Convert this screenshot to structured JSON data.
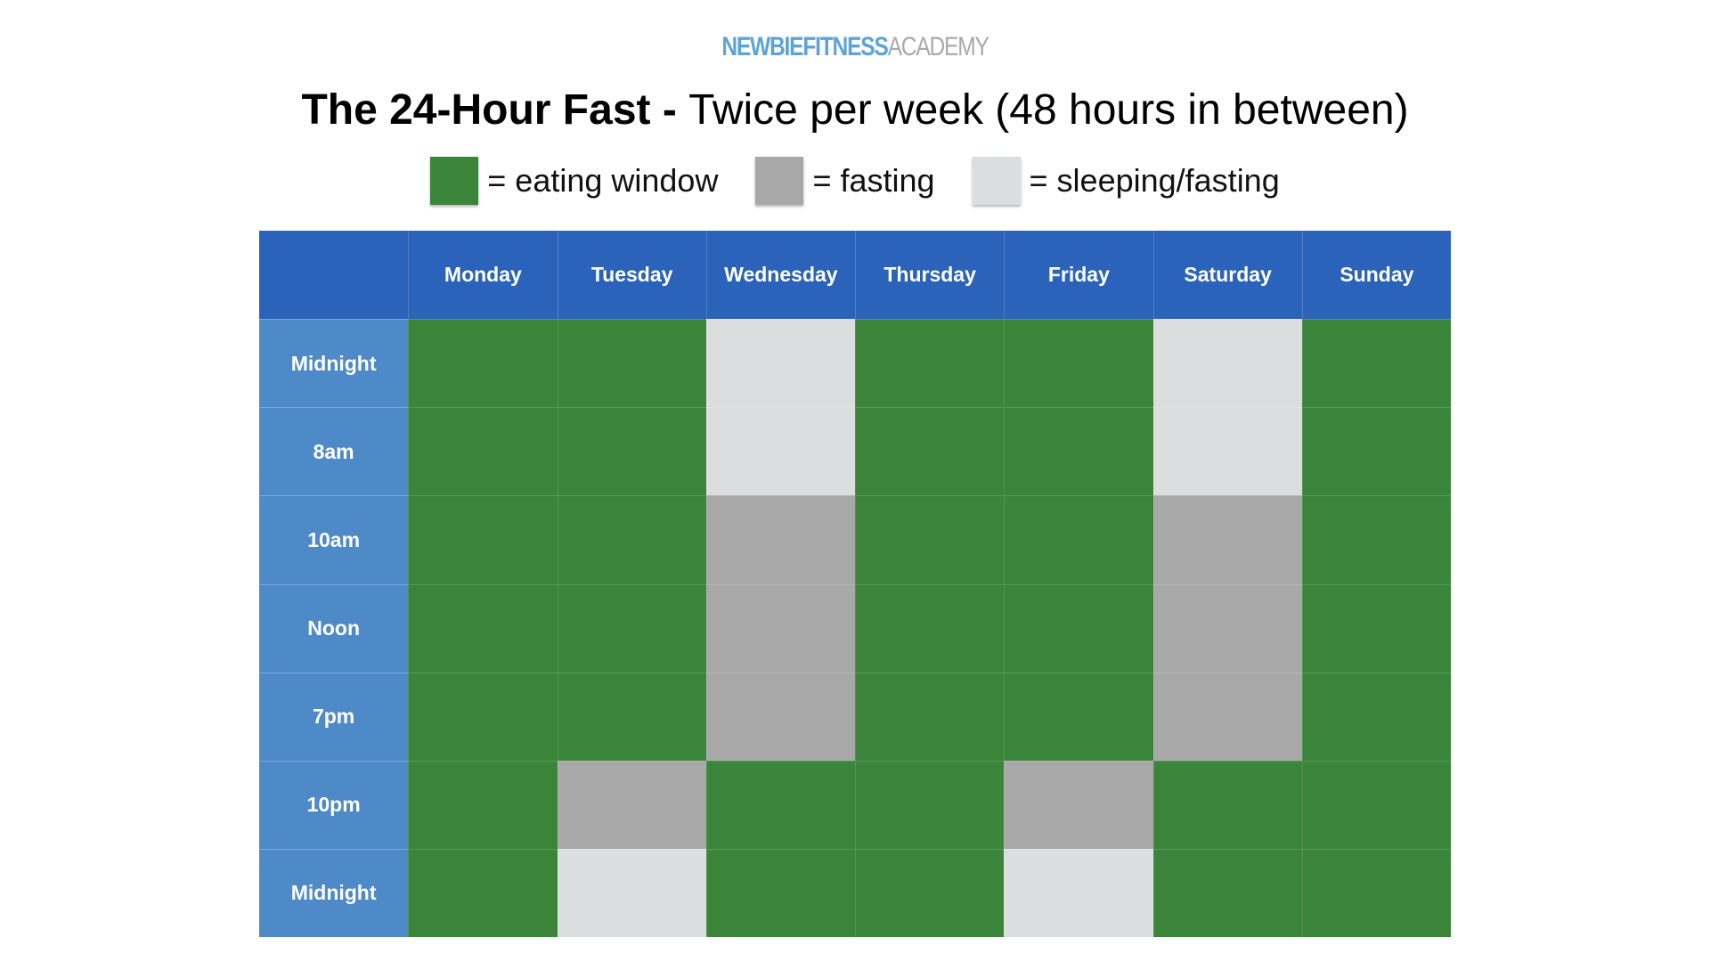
{
  "brand": {
    "part1": "NEWBIEFITNESS",
    "part2": "ACADEMY"
  },
  "title": {
    "bold": "The 24-Hour Fast - ",
    "light": "Twice per week (48 hours in between)"
  },
  "colors": {
    "eat": "#3b853a",
    "fast": "#a7a8a7",
    "sleep": "#dcdddf",
    "header": "#2b63ba",
    "row_header": "#4f8ac8"
  },
  "legend": [
    {
      "key": "eat",
      "label": "= eating window"
    },
    {
      "key": "fast",
      "label": "= fasting"
    },
    {
      "key": "sleep",
      "label": "= sleeping/fasting"
    }
  ],
  "chart_data": {
    "type": "heatmap",
    "title": "The 24-Hour Fast - Twice per week (48 hours in between)",
    "columns": [
      "Monday",
      "Tuesday",
      "Wednesday",
      "Thursday",
      "Friday",
      "Saturday",
      "Sunday"
    ],
    "rows": [
      "Midnight",
      "8am",
      "10am",
      "Noon",
      "7pm",
      "10pm",
      "Midnight"
    ],
    "legend": {
      "eat": "eating window",
      "fast": "fasting",
      "sleep": "sleeping/fasting"
    },
    "cells": [
      [
        "eat",
        "eat",
        "sleep",
        "eat",
        "eat",
        "sleep",
        "eat"
      ],
      [
        "eat",
        "eat",
        "sleep",
        "eat",
        "eat",
        "sleep",
        "eat"
      ],
      [
        "eat",
        "eat",
        "fast",
        "eat",
        "eat",
        "fast",
        "eat"
      ],
      [
        "eat",
        "eat",
        "fast",
        "eat",
        "eat",
        "fast",
        "eat"
      ],
      [
        "eat",
        "eat",
        "fast",
        "eat",
        "eat",
        "fast",
        "eat"
      ],
      [
        "eat",
        "fast",
        "eat",
        "eat",
        "fast",
        "eat",
        "eat"
      ],
      [
        "eat",
        "sleep",
        "eat",
        "eat",
        "sleep",
        "eat",
        "eat"
      ]
    ]
  }
}
